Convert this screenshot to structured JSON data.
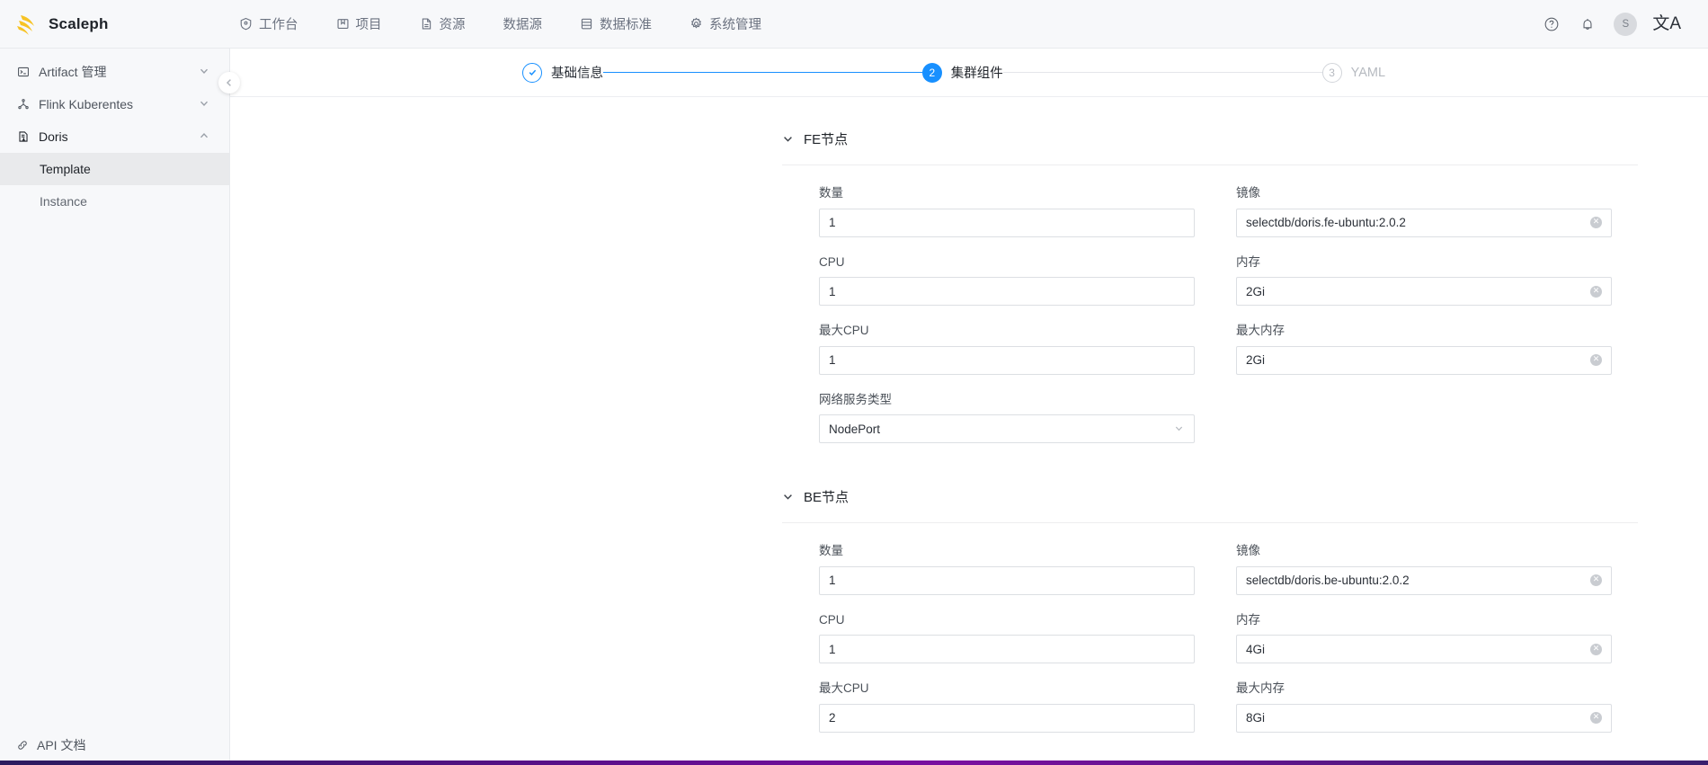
{
  "header": {
    "brand": "Scaleph",
    "nav": [
      {
        "label": "工作台",
        "icon": "dashboard-icon"
      },
      {
        "label": "项目",
        "icon": "project-icon"
      },
      {
        "label": "资源",
        "icon": "file-icon"
      },
      {
        "label": "数据源",
        "icon": "none"
      },
      {
        "label": "数据标准",
        "icon": "list-icon"
      },
      {
        "label": "系统管理",
        "icon": "gear-icon"
      }
    ],
    "help_icon": "question-circle-icon",
    "bell_icon": "bell-icon",
    "avatar_initial": "S",
    "language_icon": "translate-icon"
  },
  "sidebar": {
    "groups": [
      {
        "label": "Artifact 管理",
        "icon": "terminal-icon",
        "expanded": false,
        "children": []
      },
      {
        "label": "Flink Kuberentes",
        "icon": "flink-icon",
        "expanded": false,
        "children": []
      },
      {
        "label": "Doris",
        "icon": "doris-icon",
        "expanded": true,
        "children": [
          {
            "label": "Template",
            "active": true
          },
          {
            "label": "Instance",
            "active": false
          }
        ]
      }
    ],
    "footer": {
      "label": "API 文档",
      "icon": "link-icon"
    },
    "collapse_icon": "chevron-left-icon"
  },
  "stepper": {
    "steps": [
      {
        "number": "1",
        "label": "基础信息",
        "state": "done"
      },
      {
        "number": "2",
        "label": "集群组件",
        "state": "active"
      },
      {
        "number": "3",
        "label": "YAML",
        "state": "todo"
      }
    ]
  },
  "sections": [
    {
      "title": "FE节点",
      "collapse_icon": "chevron-down-icon",
      "fields": [
        {
          "label": "数量",
          "value": "1",
          "type": "input",
          "clearable": false
        },
        {
          "label": "镜像",
          "value": "selectdb/doris.fe-ubuntu:2.0.2",
          "type": "input",
          "clearable": true
        },
        {
          "label": "CPU",
          "value": "1",
          "type": "input",
          "clearable": false
        },
        {
          "label": "内存",
          "value": "2Gi",
          "type": "input",
          "clearable": true
        },
        {
          "label": "最大CPU",
          "value": "1",
          "type": "input",
          "clearable": false
        },
        {
          "label": "最大内存",
          "value": "2Gi",
          "type": "input",
          "clearable": true
        },
        {
          "label": "网络服务类型",
          "value": "NodePort",
          "type": "select",
          "clearable": false
        }
      ]
    },
    {
      "title": "BE节点",
      "collapse_icon": "chevron-down-icon",
      "fields": [
        {
          "label": "数量",
          "value": "1",
          "type": "input",
          "clearable": false
        },
        {
          "label": "镜像",
          "value": "selectdb/doris.be-ubuntu:2.0.2",
          "type": "input",
          "clearable": true
        },
        {
          "label": "CPU",
          "value": "1",
          "type": "input",
          "clearable": false
        },
        {
          "label": "内存",
          "value": "4Gi",
          "type": "input",
          "clearable": true
        },
        {
          "label": "最大CPU",
          "value": "2",
          "type": "input",
          "clearable": false
        },
        {
          "label": "最大内存",
          "value": "8Gi",
          "type": "input",
          "clearable": true
        }
      ]
    }
  ],
  "colors": {
    "accent": "#1890ff",
    "brand_yellow": "#f7c325",
    "header_bg": "#f7f8fa",
    "sidebar_active": "#e9eaec",
    "bottom_bar": "#5c0f8b"
  }
}
